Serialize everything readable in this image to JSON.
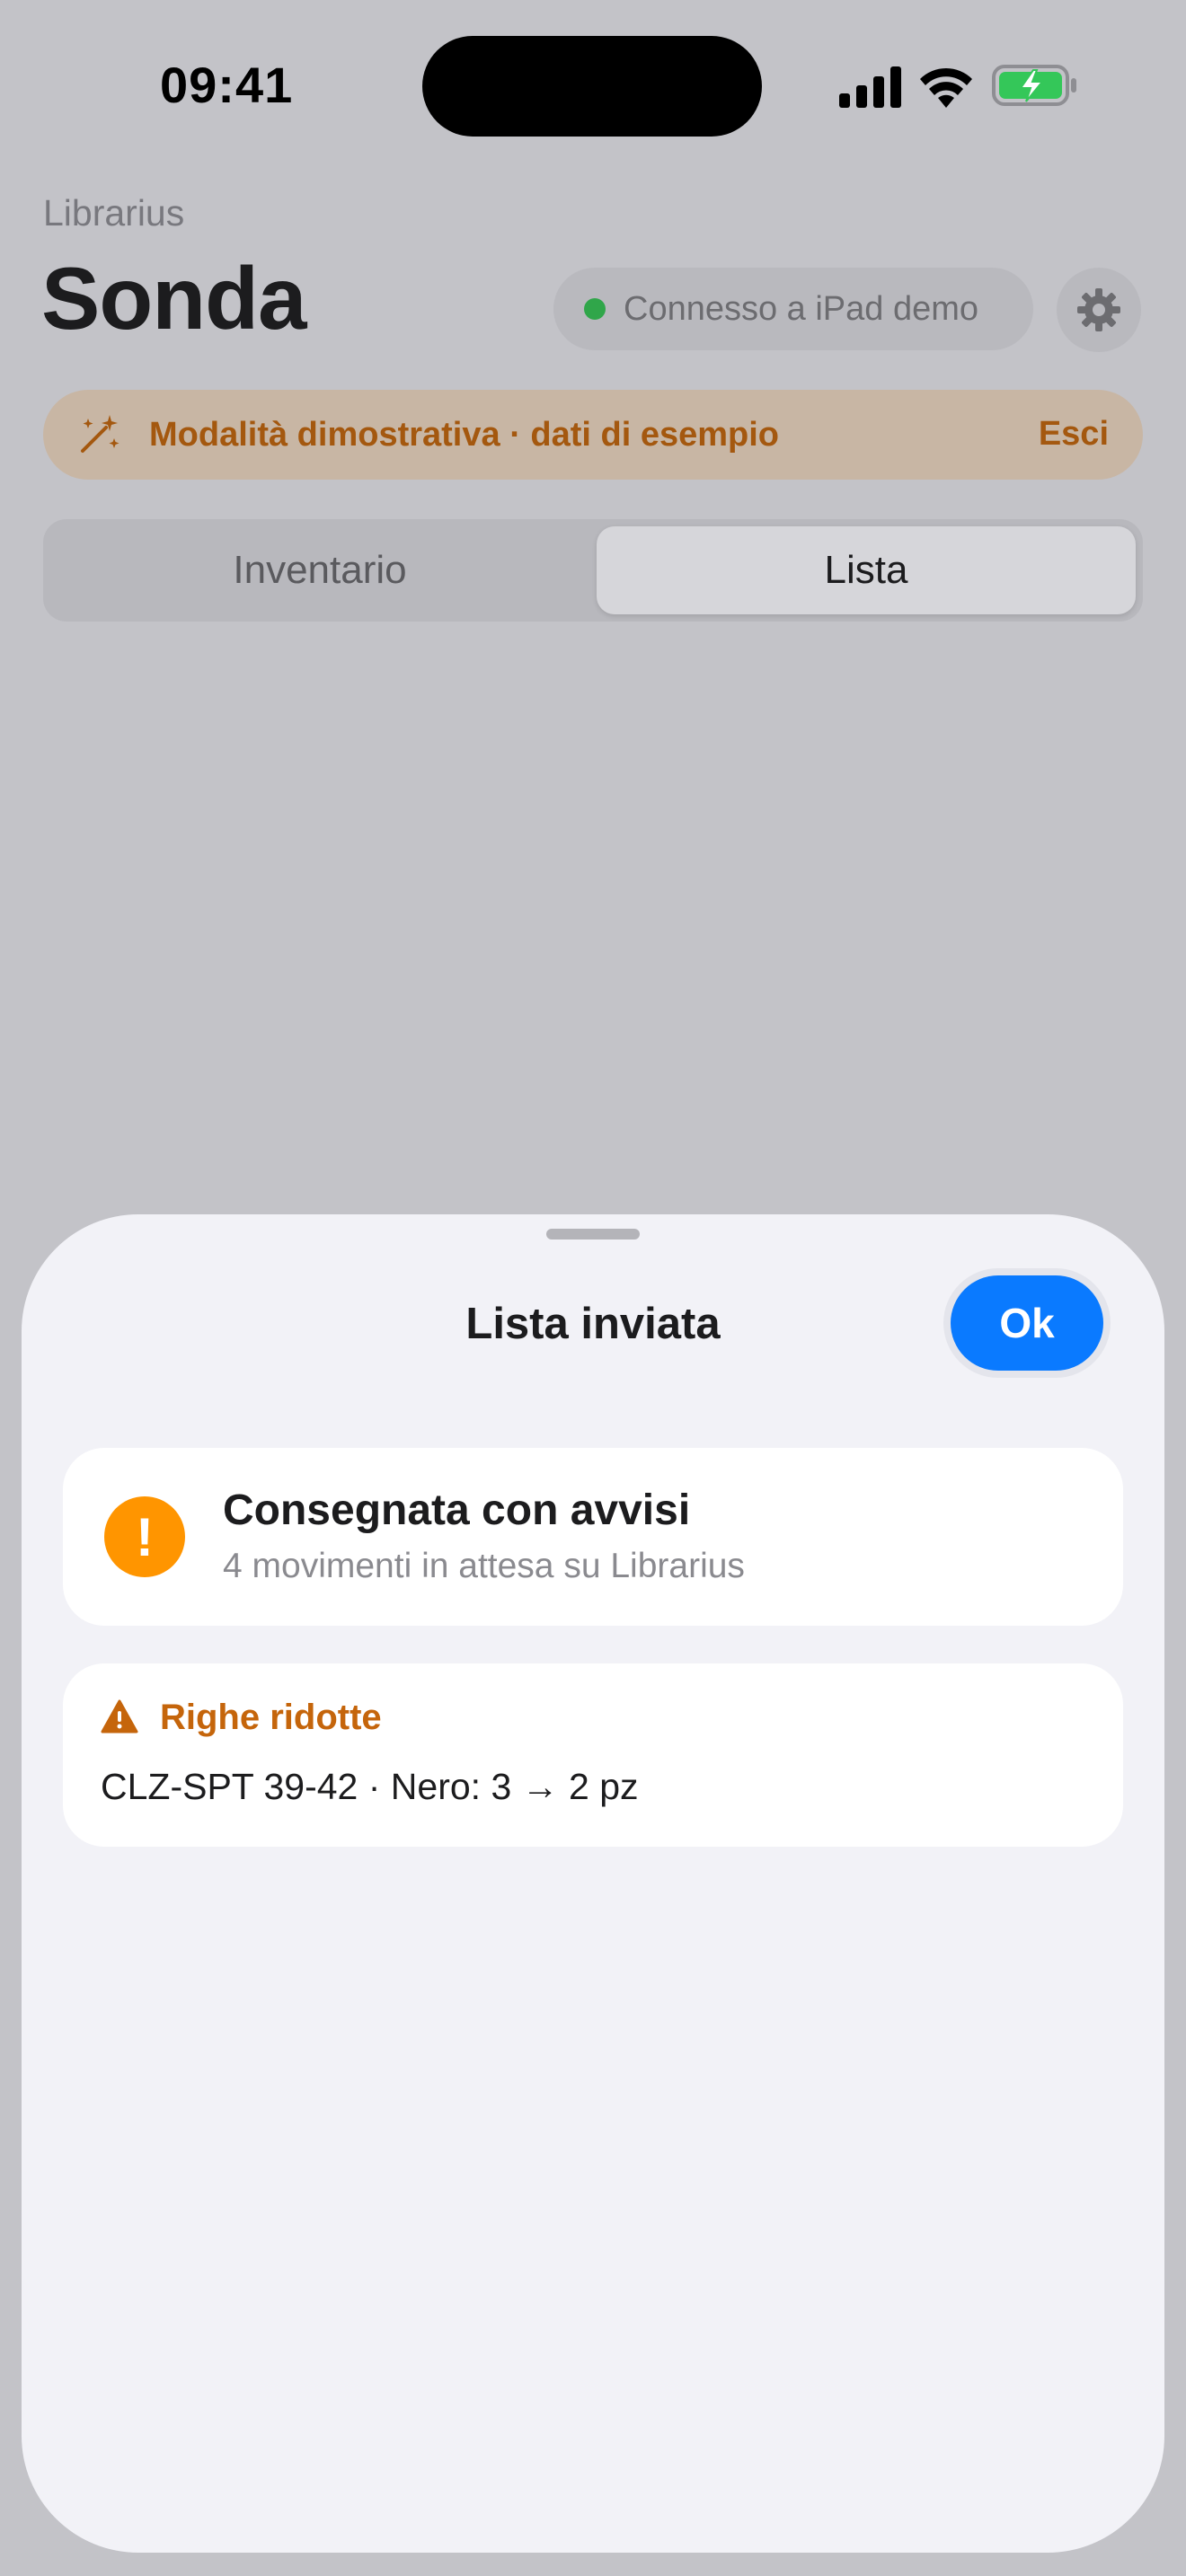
{
  "status_bar": {
    "time": "09:41",
    "icons": [
      "cellular-signal-icon",
      "wifi-icon",
      "battery-charging-icon"
    ]
  },
  "header": {
    "app_name": "Librarius",
    "title": "Sonda",
    "connection": {
      "label": "Connesso a iPad demo",
      "status_color": "#30a64a"
    },
    "settings_icon": "gear-icon"
  },
  "demo_banner": {
    "icon": "magic-wand-icon",
    "text": "Modalità dimostrativa · dati di esempio",
    "action_label": "Esci",
    "color": "#a4580f"
  },
  "tabs": [
    {
      "label": "Inventario",
      "selected": false
    },
    {
      "label": "Lista",
      "selected": true
    }
  ],
  "sheet": {
    "title": "Lista inviata",
    "ok_label": "Ok",
    "accent": "#0a7aff",
    "status": {
      "icon": "exclamation-circle-icon",
      "icon_glyph": "!",
      "title": "Consegnata con avvisi",
      "subtitle": "4 movimenti in attesa su Librarius",
      "color": "#ff9500"
    },
    "reduced_rows": {
      "icon": "warning-triangle-icon",
      "title": "Righe ridotte",
      "color": "#c5650b",
      "items": [
        "CLZ-SPT 39-42 · Nero: 3 → 2 pz"
      ]
    }
  }
}
